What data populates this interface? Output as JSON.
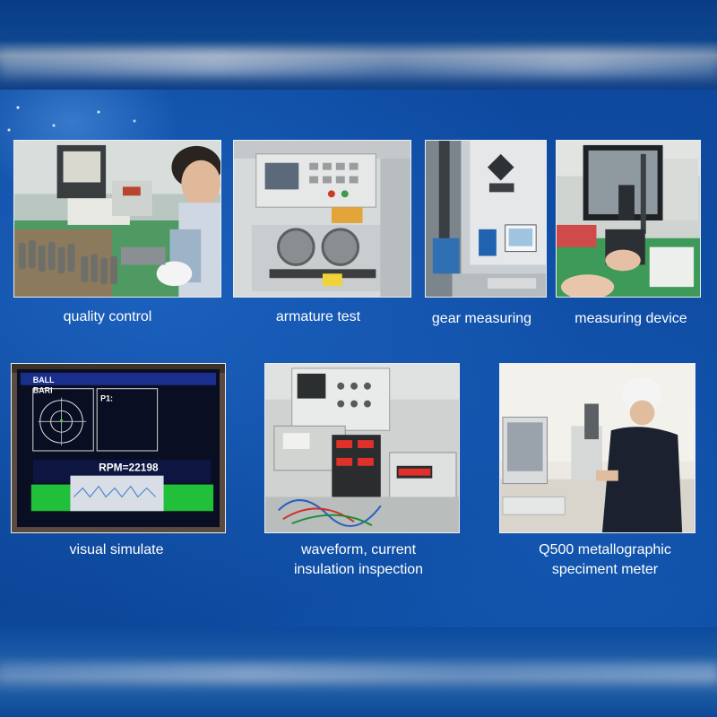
{
  "captions": {
    "quality_control": "quality control",
    "armature_test": "armature test",
    "gear_measuring": "gear measuring",
    "measuring_device": "measuring device",
    "visual_simulate": "visual simulate",
    "waveform_line1": "waveform, current",
    "waveform_line2": "insulation inspection",
    "q500_line1": "Q500 metallographic",
    "q500_line2": "speciment meter"
  },
  "screen": {
    "brand": "BALL",
    "brand2": "BARI",
    "label_p1": "P1:",
    "rpm": "RPM=22198"
  },
  "colors": {
    "background": "#0c4599",
    "caption_text": "#ffffff",
    "tile_border": "#ffffff"
  }
}
